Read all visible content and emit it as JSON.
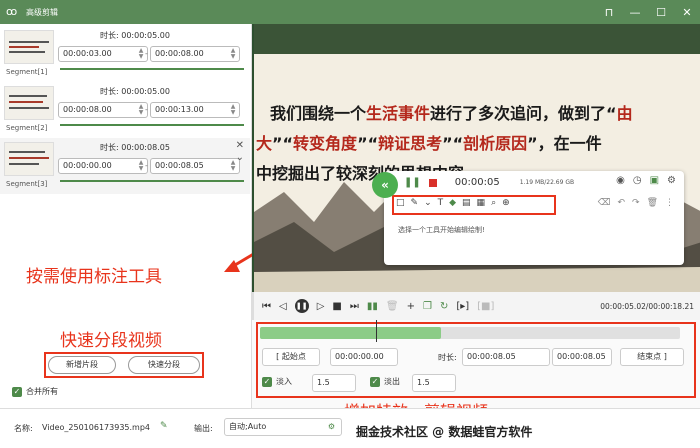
{
  "window": {
    "title": "高级剪辑",
    "pin_icon": "pin-icon",
    "minimize_icon": "minimize-icon",
    "maximize_icon": "maximize-icon",
    "close_icon": "close-icon"
  },
  "segments": [
    {
      "label": "Segment[1]",
      "duration_label": "时长:",
      "duration": "00:00:05.00",
      "start": "00:00:03.00",
      "end": "00:00:08.00"
    },
    {
      "label": "Segment[2]",
      "duration_label": "时长:",
      "duration": "00:00:05.00",
      "start": "00:00:08.00",
      "end": "00:00:13.00"
    },
    {
      "label": "Segment[3]",
      "duration_label": "时长:",
      "duration": "00:00:08.05",
      "start": "00:00:00.00",
      "end": "00:00:08.05"
    }
  ],
  "left_actions": {
    "new_segment": "新增片段",
    "quick_split": "快速分段",
    "merge_all": "合并所有"
  },
  "annotations": {
    "use_annotation_tools": "按需使用标注工具",
    "quick_split_video": "快速分段视频",
    "add_effects": "增加特效，剪辑视频"
  },
  "preview": {
    "line1_a": "我们围绕一个",
    "line1_b": "生活事件",
    "line1_c": "进行了多次追问，做到了“",
    "line1_d": "由",
    "line2_a": "大",
    "line2_b": "”“",
    "line2_c": "转变角度",
    "line2_d": "”“",
    "line2_e": "辩证思考",
    "line2_f": "”“",
    "line2_g": "剖析原因",
    "line2_h": "”，在一件",
    "line3_a": "中挖掘出了较深刻的思想内容",
    "recorder_time": "00:00:05",
    "recorder_size": "1.19 MB/22.69 GB",
    "hint": "选择一个工具开始编辑绘制!"
  },
  "controls": {
    "time_readout": "00:00:05.02/00:00:18.21"
  },
  "timeline": {
    "start_label": "起始点",
    "start_value": "00:00:00.00",
    "duration_label": "时长:",
    "duration_value": "00:00:08.05",
    "end_value": "00:00:08.05",
    "end_label": "结束点",
    "fade_in_label": "淡入",
    "fade_in_value": "1.5",
    "fade_out_label": "淡出",
    "fade_out_value": "1.5",
    "progress": 0.43
  },
  "bottom": {
    "name_label": "名称:",
    "name_value": "Video_250106173935.mp4",
    "output_label": "输出:",
    "output_value": "自动;Auto",
    "watermark": "掘金技术社区 @ 数据蛙官方软件"
  },
  "colors": {
    "accent": "#4e8a4a",
    "annotation": "#e8341c",
    "titlebar": "#5a8a58"
  }
}
